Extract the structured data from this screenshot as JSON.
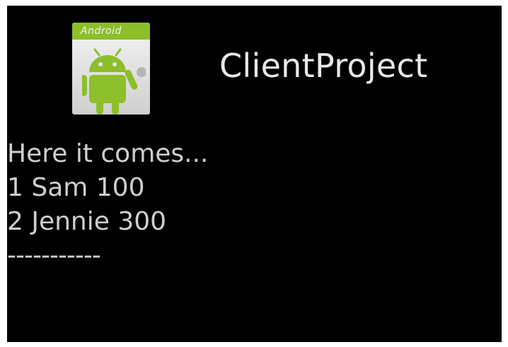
{
  "app": {
    "title": "ClientProject",
    "icon_name": "android-launcher-icon",
    "icon_band_text": "Android"
  },
  "colors": {
    "background": "#000000",
    "title_text": "#e8e8e8",
    "body_text": "#cfcfcf",
    "android_green": "#8cbf2a"
  },
  "output": {
    "lines": [
      "Here it comes...",
      "1 Sam 100",
      "2 Jennie 300",
      "-----------"
    ]
  }
}
